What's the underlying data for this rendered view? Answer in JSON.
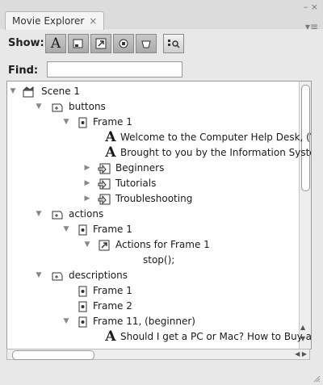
{
  "window": {
    "tab_title": "Movie Explorer",
    "tab_close": "×",
    "min_close": "– ×",
    "menu": "▾≡"
  },
  "toolbar": {
    "show_label": "Show:"
  },
  "find": {
    "label": "Find:",
    "value": ""
  },
  "tree": [
    {
      "text": "Scene 1",
      "toggle": "▼",
      "icon": "scene-icon"
    },
    {
      "text": "buttons",
      "toggle": "▼",
      "icon": "symbol-icon"
    },
    {
      "text": "Frame 1",
      "toggle": "▼",
      "icon": "frame-icon"
    },
    {
      "text": "Welcome to the Computer Help Desk, (Ve",
      "toggle": "",
      "icon": "text-icon"
    },
    {
      "text": "Brought to you by the Information Systen",
      "toggle": "",
      "icon": "text-icon"
    },
    {
      "text": "Beginners",
      "toggle": "▶",
      "icon": "button-symbol-icon"
    },
    {
      "text": "Tutorials",
      "toggle": "▶",
      "icon": "button-symbol-icon"
    },
    {
      "text": "Troubleshooting",
      "toggle": "▶",
      "icon": "button-symbol-icon"
    },
    {
      "text": "actions",
      "toggle": "▼",
      "icon": "symbol-icon"
    },
    {
      "text": "Frame 1",
      "toggle": "▼",
      "icon": "frame-icon"
    },
    {
      "text": "Actions for Frame 1",
      "toggle": "▼",
      "icon": "actions-icon"
    },
    {
      "text": "stop();",
      "toggle": "",
      "icon": ""
    },
    {
      "text": "descriptions",
      "toggle": "▼",
      "icon": "symbol-icon"
    },
    {
      "text": "Frame 1",
      "toggle": "",
      "icon": "frame-icon"
    },
    {
      "text": "Frame 2",
      "toggle": "",
      "icon": "frame-icon"
    },
    {
      "text": "Frame 11, (beginner)",
      "toggle": "▼",
      "icon": "frame-icon"
    },
    {
      "text": "Should I get a PC or Mac? How to Buy a C",
      "toggle": "",
      "icon": "text-icon"
    }
  ]
}
